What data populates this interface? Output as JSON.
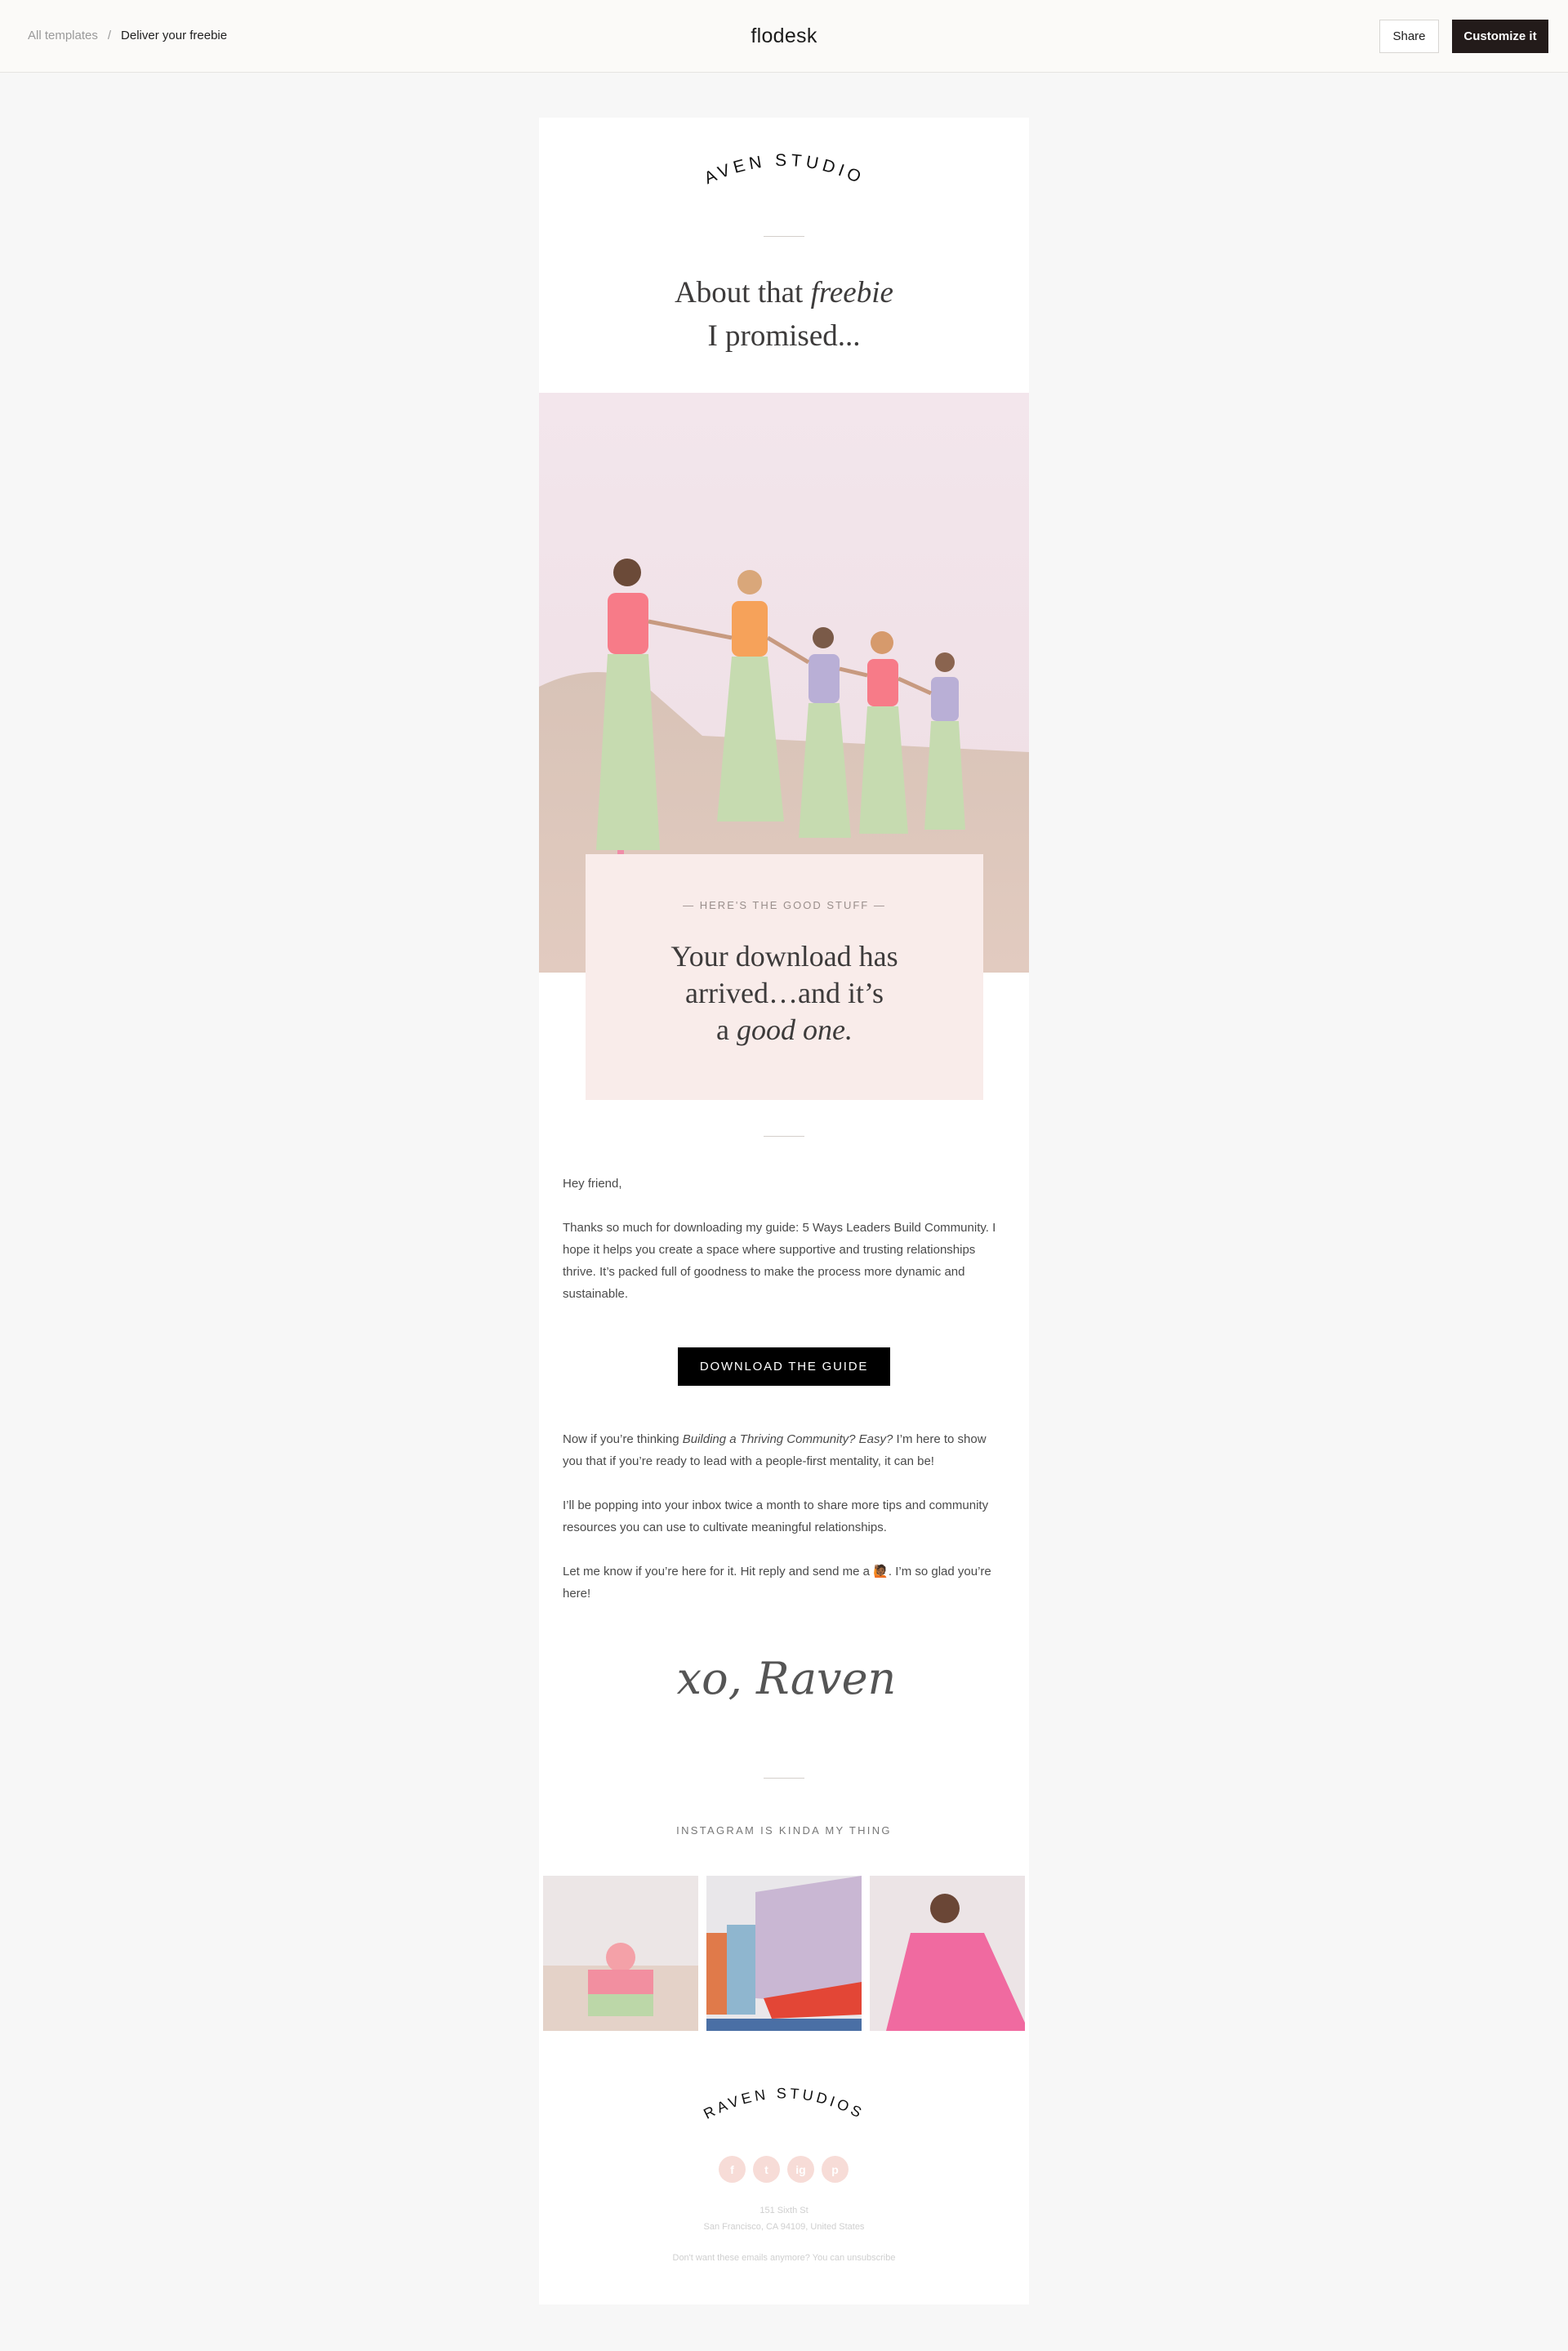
{
  "topbar": {
    "breadcrumb_root": "All templates",
    "breadcrumb_sep": "/",
    "breadcrumb_current": "Deliver your freebie",
    "brand": "flodesk",
    "share_label": "Share",
    "customize_label": "Customize it"
  },
  "email": {
    "logo_text": "RAVEN STUDIOS",
    "headline_line1": "About that ",
    "headline_em": "freebie",
    "headline_line2": "I promised...",
    "card_eyebrow": "— HERE'S THE GOOD STUFF —",
    "card_line1": "Your download has",
    "card_line2": "arrived…and it’s",
    "card_line3_prefix": "a ",
    "card_line3_em": "good one.",
    "greeting": "Hey friend,",
    "para1": "Thanks so much for downloading my guide: 5 Ways Leaders Build Community. I hope it helps you create a space where supportive and trusting relationships thrive. It’s packed full of goodness to make the process more dynamic and sustainable.",
    "cta_label": "DOWNLOAD THE GUIDE",
    "para2_prefix": "Now if you’re thinking ",
    "para2_em": "Building a Thriving Community? Easy?",
    "para2_suffix": " I’m here to show you that if you’re ready to lead with a people-first mentality, it can be!",
    "para3": "I’ll be popping into your inbox twice a month to share more tips and community resources you can use to cultivate meaningful relationships.",
    "para4_prefix": "Let me know if you’re here for it. Hit reply and send me a ",
    "para4_emoji": "🙋🏾",
    "para4_suffix": ". I’m so glad you’re here!",
    "signature": "xo, Raven",
    "instagram_title": "INSTAGRAM IS KINDA MY THING",
    "footer_logo_text": "RAVEN STUDIOS",
    "social": [
      "f",
      "t",
      "ig",
      "p"
    ],
    "address_line1": "151 Sixth St",
    "address_line2": "San Francisco, CA 94109, United States",
    "unsubscribe": "Don't want these emails anymore? You can unsubscribe"
  },
  "colors": {
    "accent_dark": "#231b1a",
    "card_bg": "#f9ecea",
    "social_bg": "#f7dcd7",
    "page_bg": "#f7f7f7"
  }
}
